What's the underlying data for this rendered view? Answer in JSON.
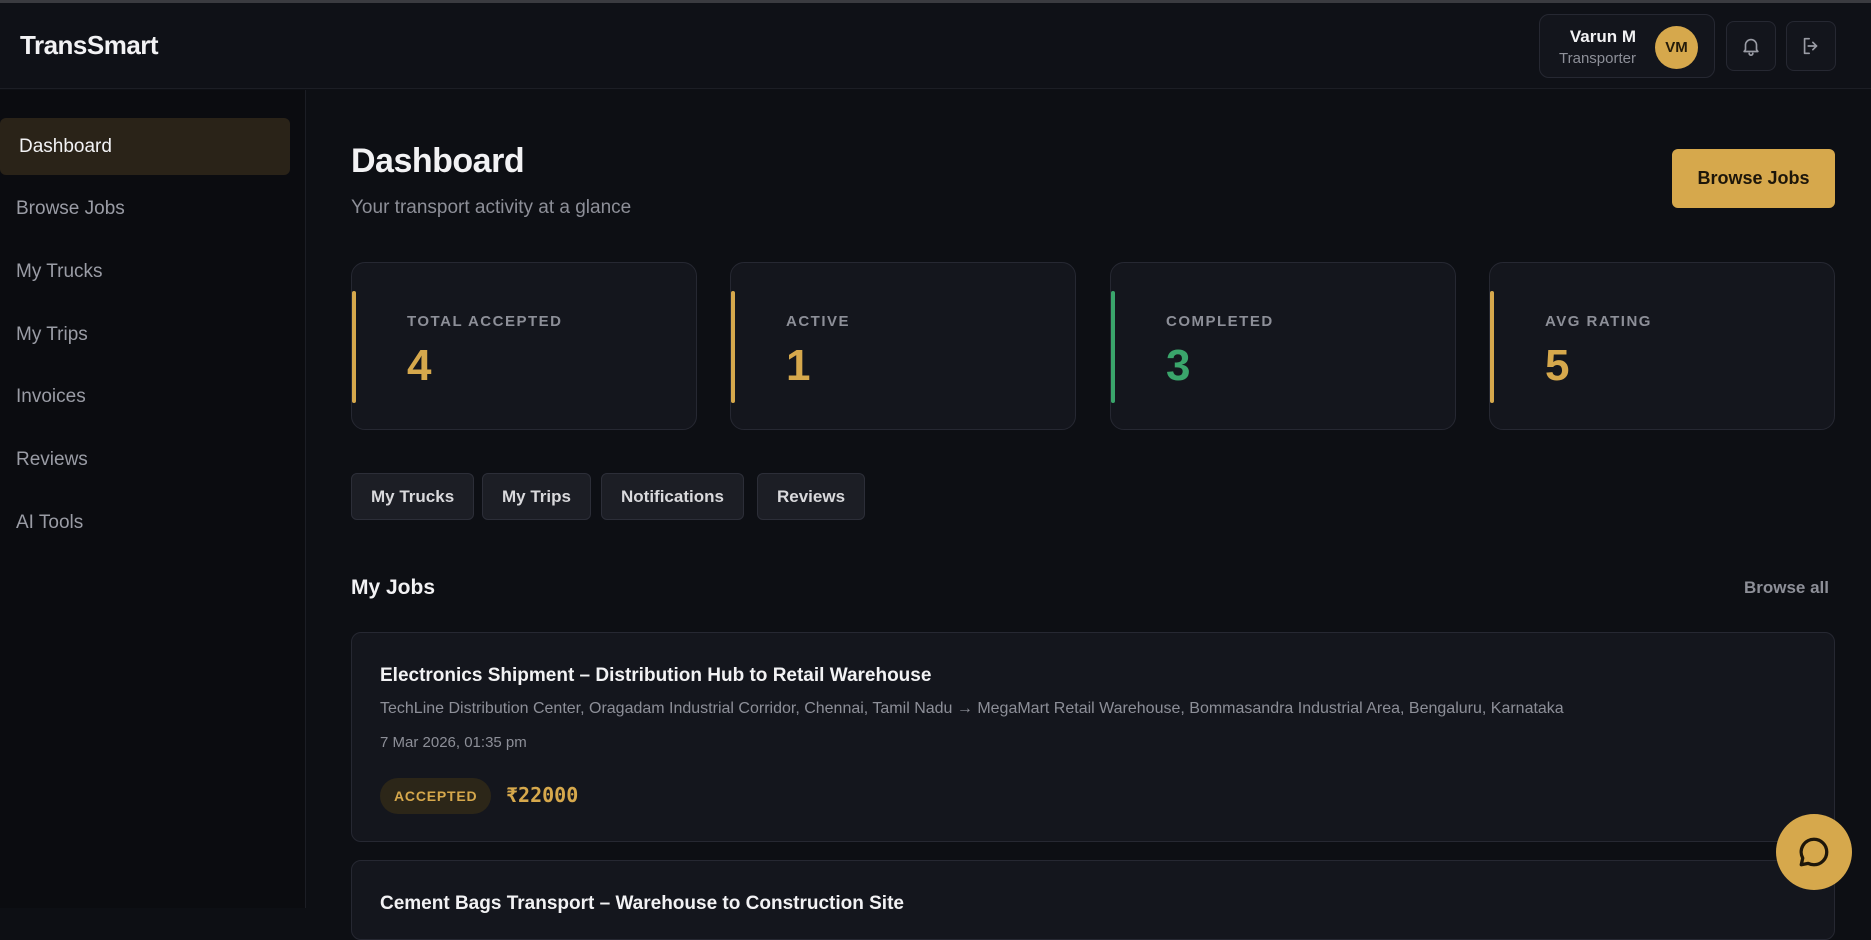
{
  "header": {
    "brand": "TransSmart",
    "user": {
      "name": "Varun M",
      "role": "Transporter",
      "initials": "VM"
    },
    "icons": [
      "bell-icon",
      "logout-icon"
    ]
  },
  "sidebar": {
    "items": [
      {
        "label": "Dashboard",
        "active": true
      },
      {
        "label": "Browse Jobs"
      },
      {
        "label": "My Trucks"
      },
      {
        "label": "My Trips"
      },
      {
        "label": "Invoices"
      },
      {
        "label": "Reviews"
      },
      {
        "label": "AI Tools"
      }
    ]
  },
  "page": {
    "title": "Dashboard",
    "subtitle": "Your transport activity at a glance",
    "primary_action": "Browse Jobs"
  },
  "stats": [
    {
      "label": "TOTAL ACCEPTED",
      "value": "4",
      "color": "#d6a84c"
    },
    {
      "label": "ACTIVE",
      "value": "1",
      "color": "#d6a84c"
    },
    {
      "label": "COMPLETED",
      "value": "3",
      "color": "#3aa56b"
    },
    {
      "label": "AVG RATING",
      "value": "5",
      "color": "#d6a84c"
    }
  ],
  "quick_links": [
    "My Trucks",
    "My Trips",
    "Notifications",
    "Reviews"
  ],
  "jobs_section": {
    "title": "My Jobs",
    "link": "Browse all",
    "jobs": [
      {
        "title": "Electronics Shipment – Distribution Hub to Retail Warehouse",
        "route": "TechLine Distribution Center, Oragadam Industrial Corridor, Chennai, Tamil Nadu → MegaMart Retail Warehouse, Bommasandra Industrial Area, Bengaluru, Karnataka",
        "date": "7 Mar 2026, 01:35 pm",
        "status": "ACCEPTED",
        "price": "₹22000"
      },
      {
        "title": "Cement Bags Transport – Warehouse to Construction Site"
      }
    ]
  },
  "colors": {
    "accent": "#d6a84c",
    "success": "#3aa56b",
    "background": "#0d0f14",
    "card": "#14161d"
  },
  "chat": {
    "icon": "chat-bubble-icon"
  }
}
